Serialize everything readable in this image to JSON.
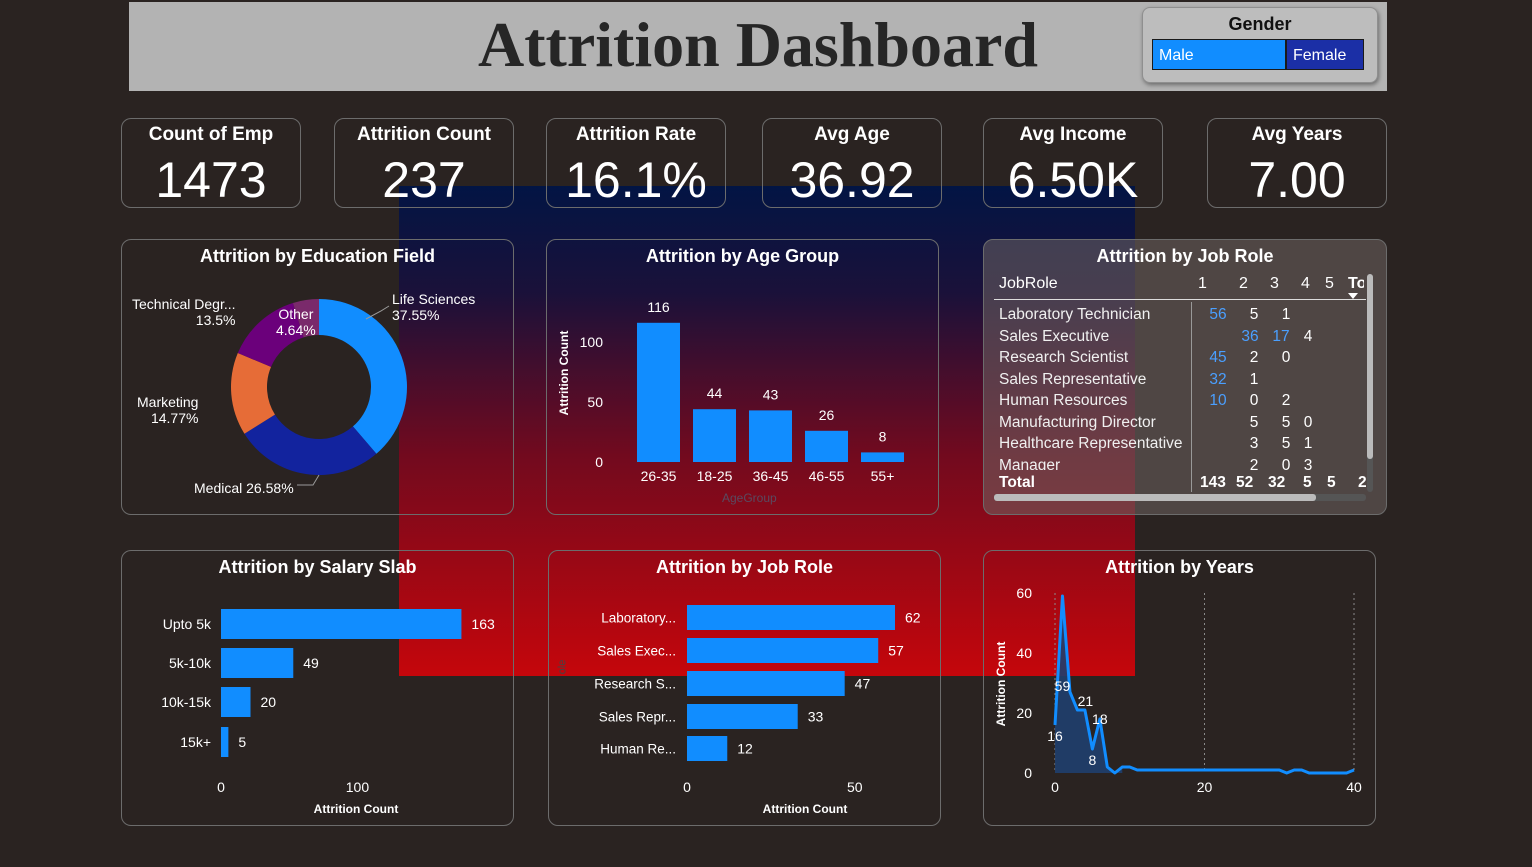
{
  "header": {
    "title": "Attrition Dashboard"
  },
  "slicer": {
    "title": "Gender",
    "options": [
      "Male",
      "Female"
    ],
    "selected": "Male"
  },
  "kpis": [
    {
      "label": "Count of Emp",
      "value": "1473"
    },
    {
      "label": "Attrition Count",
      "value": "237"
    },
    {
      "label": "Attrition Rate",
      "value": "16.1%"
    },
    {
      "label": "Avg Age",
      "value": "36.92"
    },
    {
      "label": "Avg Income",
      "value": "6.50K"
    },
    {
      "label": "Avg Years",
      "value": "7.00"
    }
  ],
  "colors": {
    "primary": "#118dff",
    "dark_blue": "#12239e",
    "orange": "#e66c37",
    "purple": "#6b007b",
    "pink_purple": "#7a2a6b",
    "background": "#2a2321",
    "header": "#b3b3b3",
    "glow_top": "#001446",
    "glow_bottom": "#cd040a"
  },
  "chart_data": [
    {
      "type": "pie",
      "title": "Attrition by Education Field",
      "labels": [
        "Life Sciences",
        "Medical",
        "Marketing",
        "Technical Degr...",
        "Other"
      ],
      "values": [
        37.55,
        26.58,
        14.77,
        13.5,
        4.64
      ],
      "display_labels": [
        "Life Sciences\n37.55%",
        "Medical 26.58%",
        "Marketing\n14.77%",
        "Technical Degr...\n13.5%",
        "Other\n4.64%"
      ],
      "colors": [
        "#118dff",
        "#12239e",
        "#e66c37",
        "#6b007b",
        "#7a2a6b"
      ]
    },
    {
      "type": "bar",
      "title": "Attrition by Age Group",
      "categories": [
        "26-35",
        "18-25",
        "36-45",
        "46-55",
        "55+"
      ],
      "values": [
        116,
        44,
        43,
        26,
        8
      ],
      "ylabel": "Attrition Count",
      "xlabel": "AgeGroup",
      "yticks": [
        "0",
        "50",
        "100"
      ],
      "ylim": [
        0,
        125
      ]
    },
    {
      "type": "bar",
      "orientation": "horizontal",
      "title": "Attrition by Salary Slab",
      "categories": [
        "Upto 5k",
        "5k-10k",
        "10k-15k",
        "15k+"
      ],
      "values": [
        163,
        49,
        20,
        5
      ],
      "xlabel": "Attrition Count",
      "xticks": [
        "0",
        "100"
      ],
      "xlim": [
        0,
        160
      ]
    },
    {
      "type": "bar",
      "orientation": "horizontal",
      "title": "Attrition by Job Role",
      "categories": [
        "Laboratory...",
        "Sales Exec...",
        "Research S...",
        "Sales Repr...",
        "Human Re..."
      ],
      "values": [
        62,
        57,
        47,
        33,
        12
      ],
      "xlabel": "Attrition Count",
      "ylabel": "ole",
      "xticks": [
        "0",
        "50"
      ],
      "xlim": [
        0,
        62
      ]
    },
    {
      "type": "area",
      "title": "Attrition by Years",
      "x": [
        0,
        1,
        2,
        3,
        4,
        5,
        6,
        7,
        8,
        9,
        10,
        11,
        12,
        13,
        14,
        15,
        16,
        17,
        18,
        19,
        20,
        21,
        22,
        23,
        24,
        25,
        26,
        27,
        28,
        29,
        30,
        31,
        32,
        33,
        34,
        35,
        36,
        37,
        38,
        39,
        40
      ],
      "y": [
        16,
        59,
        27,
        21,
        21,
        8,
        18,
        2,
        0,
        2,
        2,
        1,
        1,
        1,
        1,
        1,
        1,
        1,
        1,
        1,
        1,
        1,
        1,
        1,
        1,
        1,
        1,
        1,
        1,
        1,
        1,
        0,
        1,
        1,
        0,
        0,
        0,
        0,
        0,
        0,
        1
      ],
      "point_labels": [
        {
          "x": 0,
          "label": "16"
        },
        {
          "x": 1,
          "label": "59"
        },
        {
          "x": 3,
          "label": "21"
        },
        {
          "x": 5,
          "label": "8"
        },
        {
          "x": 6,
          "label": "18"
        }
      ],
      "ylabel": "Attrition Count",
      "xticks": [
        "0",
        "20",
        "40"
      ],
      "yticks": [
        "0",
        "20",
        "40",
        "60"
      ],
      "xlim": [
        0,
        40
      ],
      "ylim": [
        0,
        60
      ]
    }
  ],
  "job_role_table": {
    "title": "Attrition by Job Role",
    "columns": [
      "JobRole",
      "1",
      "2",
      "3",
      "4",
      "5",
      "To"
    ],
    "rows": [
      {
        "role": "Laboratory Technician",
        "cells": [
          "56",
          "5",
          "1",
          "",
          ""
        ]
      },
      {
        "role": "Sales Executive",
        "cells": [
          "",
          "36",
          "17",
          "4",
          ""
        ]
      },
      {
        "role": "Research Scientist",
        "cells": [
          "45",
          "2",
          "0",
          "",
          ""
        ]
      },
      {
        "role": "Sales Representative",
        "cells": [
          "32",
          "1",
          "",
          "",
          ""
        ]
      },
      {
        "role": "Human Resources",
        "cells": [
          "10",
          "0",
          "2",
          "",
          ""
        ]
      },
      {
        "role": "Manufacturing Director",
        "cells": [
          "",
          "5",
          "5",
          "0",
          ""
        ]
      },
      {
        "role": "Healthcare Representative",
        "cells": [
          "",
          "3",
          "5",
          "1",
          ""
        ]
      },
      {
        "role": "Manager",
        "cells": [
          "",
          "2",
          "0",
          "3",
          ""
        ]
      }
    ],
    "total": {
      "label": "Total",
      "cells": [
        "143",
        "52",
        "32",
        "5",
        "5",
        "2"
      ]
    }
  }
}
